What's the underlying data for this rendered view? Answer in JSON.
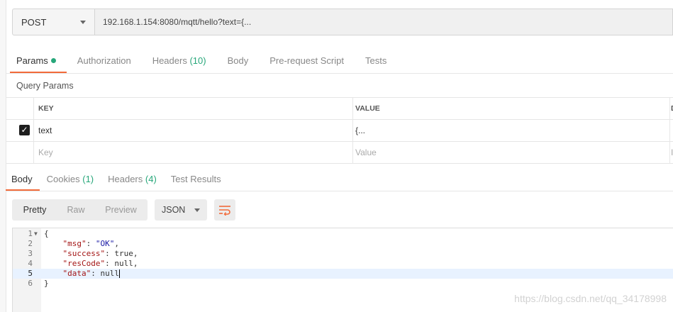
{
  "request": {
    "method": "POST",
    "url": "192.168.1.154:8080/mqtt/hello?text={..."
  },
  "request_tabs": [
    {
      "label": "Params",
      "count": "",
      "active": true
    },
    {
      "label": "Authorization",
      "count": "",
      "active": false
    },
    {
      "label": "Headers",
      "count": "(10)",
      "active": false
    },
    {
      "label": "Body",
      "count": "",
      "active": false
    },
    {
      "label": "Pre-request Script",
      "count": "",
      "active": false
    },
    {
      "label": "Tests",
      "count": "",
      "active": false
    }
  ],
  "query_params": {
    "title": "Query Params",
    "headers": {
      "key": "KEY",
      "value": "VALUE",
      "description": "D"
    },
    "rows": [
      {
        "checked": true,
        "key": "text",
        "value": "{..."
      }
    ],
    "placeholder": {
      "key": "Key",
      "value": "Value",
      "description": "I"
    }
  },
  "response_tabs": [
    {
      "label": "Body",
      "count": "",
      "active": true
    },
    {
      "label": "Cookies",
      "count": "(1)",
      "active": false
    },
    {
      "label": "Headers",
      "count": "(4)",
      "active": false
    },
    {
      "label": "Test Results",
      "count": "",
      "active": false
    }
  ],
  "response_toolbar": {
    "views": [
      "Pretty",
      "Raw",
      "Preview"
    ],
    "active_view": "Pretty",
    "format": "JSON"
  },
  "response_body": {
    "lines": [
      {
        "n": "1",
        "fold": true
      },
      {
        "n": "2"
      },
      {
        "n": "3"
      },
      {
        "n": "4"
      },
      {
        "n": "5",
        "highlight": true
      },
      {
        "n": "6"
      }
    ],
    "json": {
      "msg_key": "\"msg\"",
      "msg_val": "\"OK\"",
      "success_key": "\"success\"",
      "success_val": "true",
      "resCode_key": "\"resCode\"",
      "resCode_val": "null",
      "data_key": "\"data\"",
      "data_val": "null"
    }
  },
  "watermark": "https://blog.csdn.net/qq_34178998",
  "colors": {
    "accent": "#f26b3a",
    "count_green": "#27a77a"
  }
}
